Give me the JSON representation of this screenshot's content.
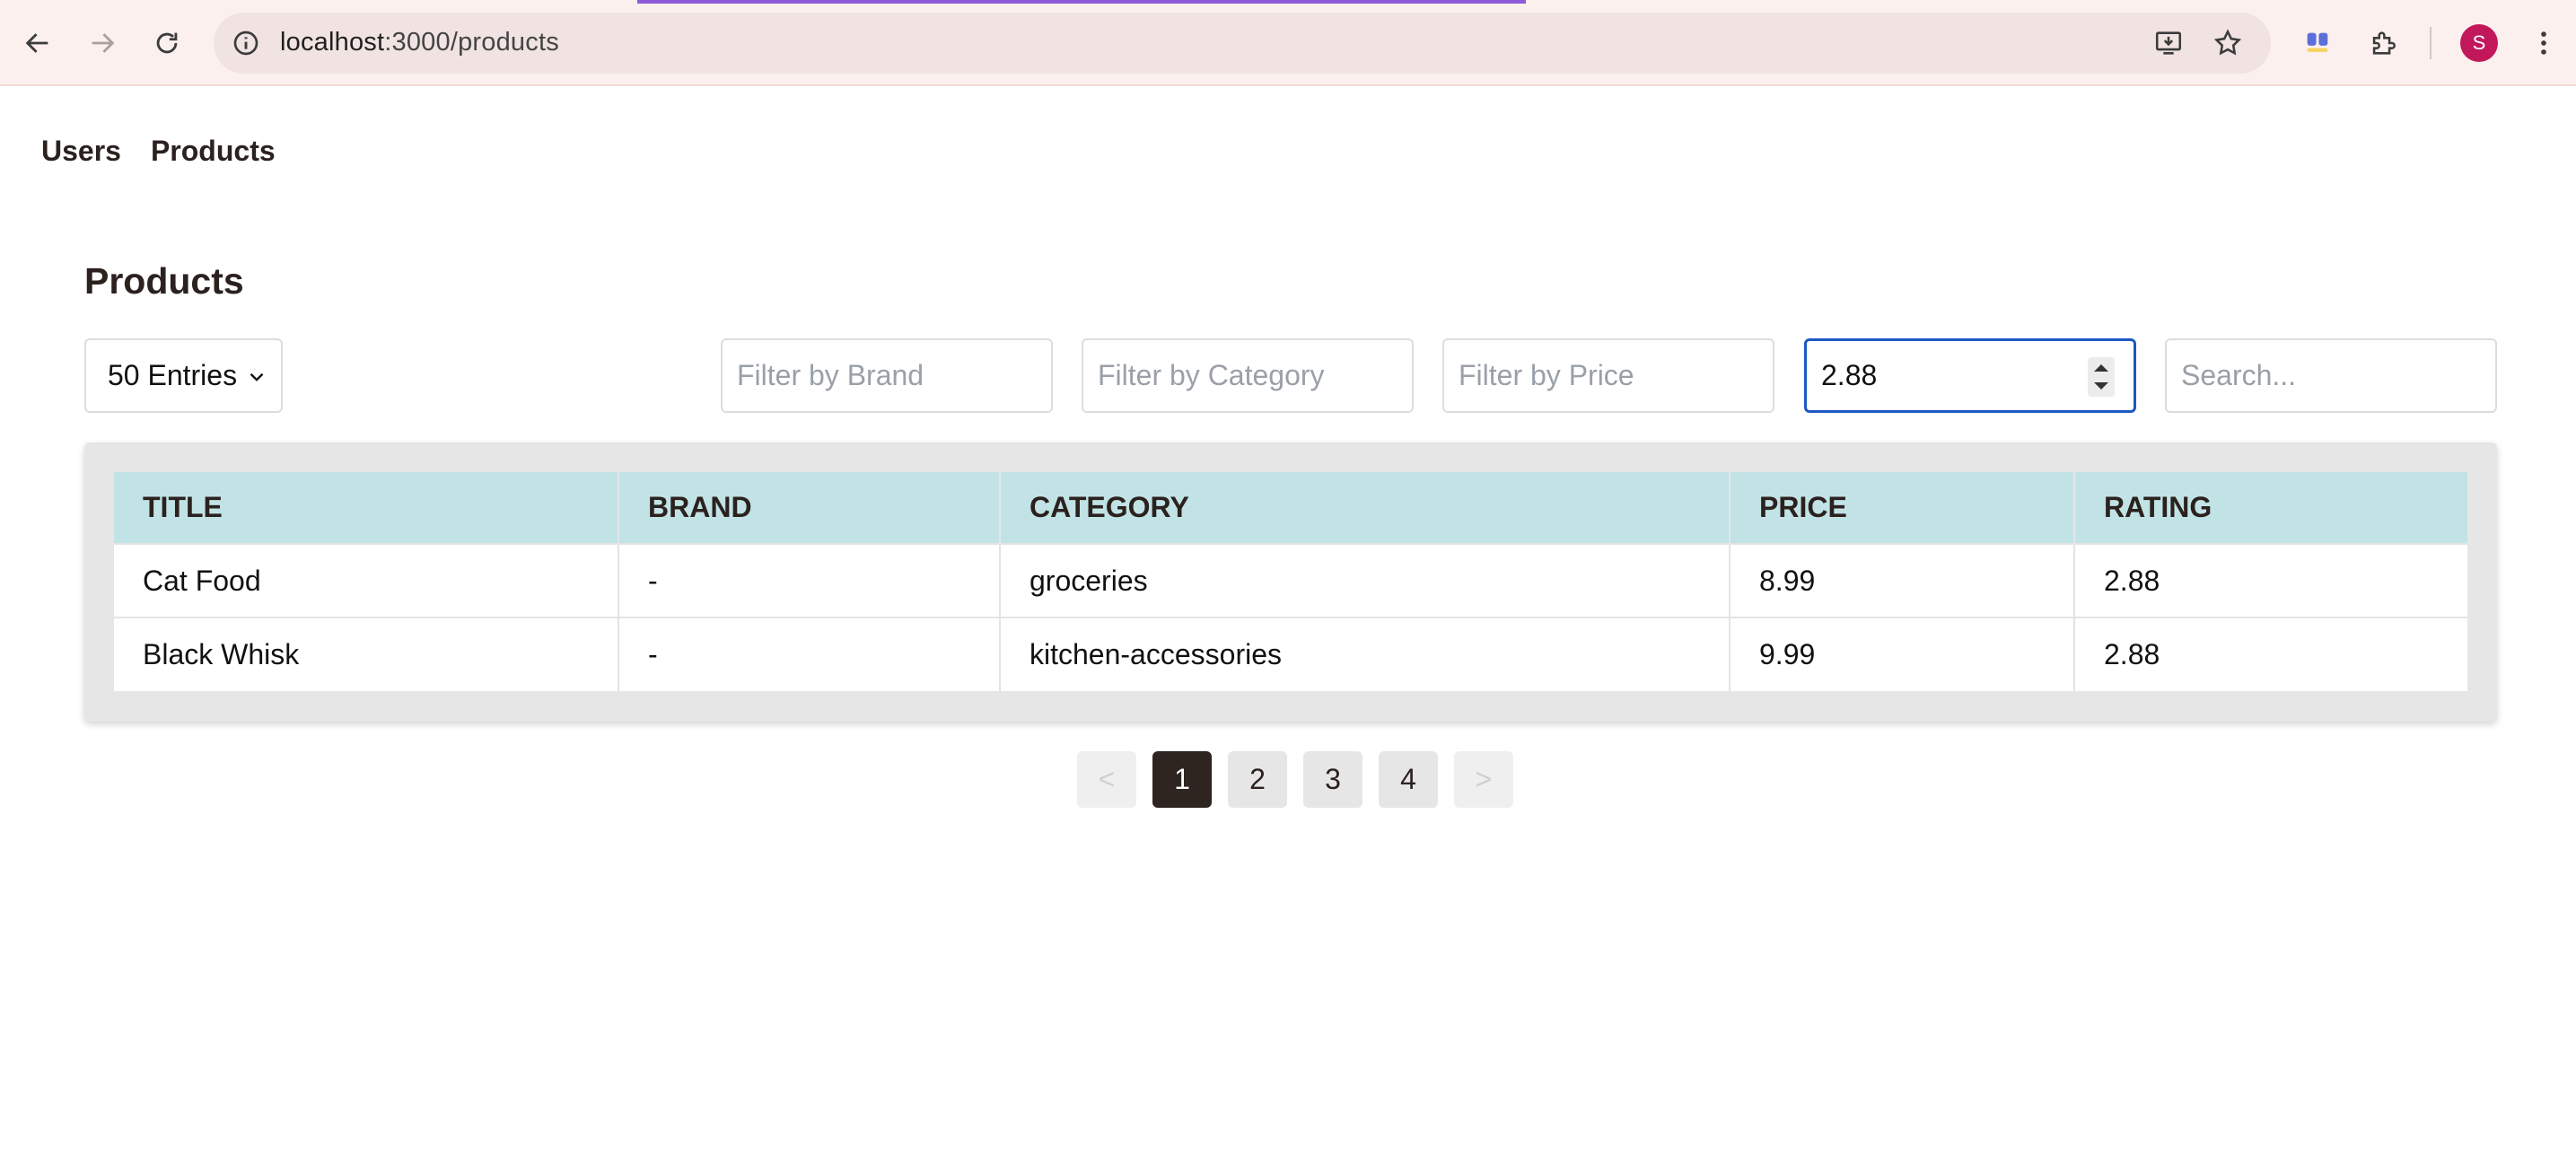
{
  "browser": {
    "url_host": "localhost",
    "url_path": ":3000/products",
    "avatar_initial": "S"
  },
  "nav": {
    "users": "Users",
    "products": "Products"
  },
  "page": {
    "title": "Products"
  },
  "controls": {
    "entries_label": "50 Entries",
    "brand_placeholder": "Filter by Brand",
    "category_placeholder": "Filter by Category",
    "price_placeholder": "Filter by Price",
    "rating_value": "2.88",
    "search_placeholder": "Search..."
  },
  "table": {
    "headers": [
      "TITLE",
      "BRAND",
      "CATEGORY",
      "PRICE",
      "RATING"
    ],
    "rows": [
      [
        "Cat Food",
        "-",
        "groceries",
        "8.99",
        "2.88"
      ],
      [
        "Black Whisk",
        "-",
        "kitchen-accessories",
        "9.99",
        "2.88"
      ]
    ]
  },
  "pagination": {
    "prev": "<",
    "pages": [
      "1",
      "2",
      "3",
      "4"
    ],
    "next": ">",
    "active_page": "1"
  },
  "colors": {
    "header_bg": "#c1e3e6",
    "active_page": "#2e2420",
    "focus_border": "#1f57c3"
  }
}
